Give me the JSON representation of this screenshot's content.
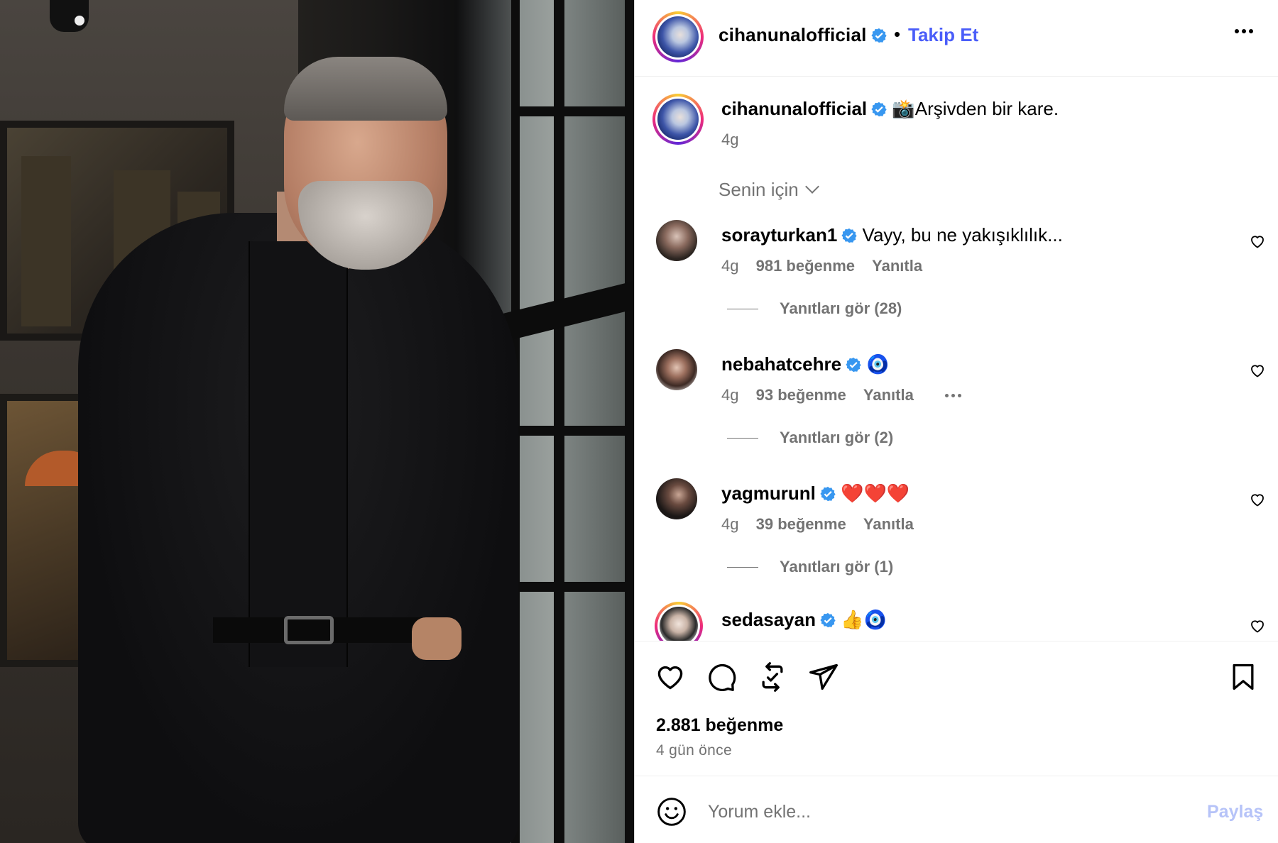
{
  "post": {
    "username": "cihanunalofficial",
    "follow_label": "Takip Et",
    "caption_emoji": "📸",
    "caption": "Arşivden bir kare.",
    "caption_time": "4g",
    "filter_label": "Senin için"
  },
  "comments": [
    {
      "username": "sorayturkan1",
      "text": "Vayy, bu ne yakışıklılık...",
      "time": "4g",
      "likes": "981 beğenme",
      "reply": "Yanıtla",
      "view_replies": "Yanıtları gör (28)"
    },
    {
      "username": "nebahatcehre",
      "text": "🧿",
      "time": "4g",
      "likes": "93 beğenme",
      "reply": "Yanıtla",
      "view_replies": "Yanıtları gör (2)"
    },
    {
      "username": "yagmurunl",
      "text": "❤️❤️❤️",
      "time": "4g",
      "likes": "39 beğenme",
      "reply": "Yanıtla",
      "view_replies": "Yanıtları gör (1)"
    },
    {
      "username": "sedasayan",
      "text": "👍🧿"
    }
  ],
  "stats": {
    "likes": "2.881 beğenme",
    "date": "4 gün önce"
  },
  "composer": {
    "placeholder": "Yorum ekle...",
    "share_label": "Paylaş"
  },
  "colors": {
    "accent": "#4a5df9",
    "secondary_text": "#737373",
    "share_disabled": "#b6c3f8",
    "verified": "#3897f0"
  }
}
